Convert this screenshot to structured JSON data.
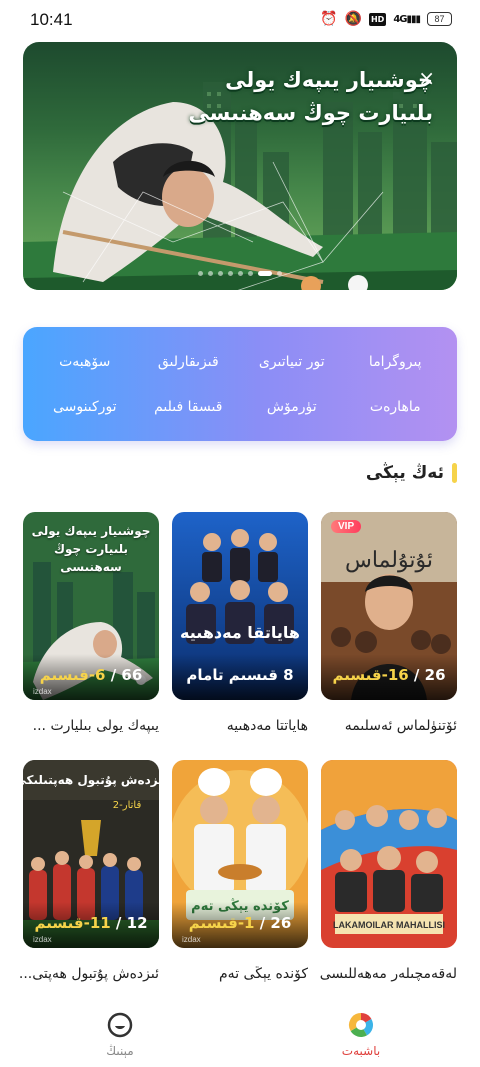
{
  "status_bar": {
    "time": "10:41",
    "network": "4G",
    "hd": "HD",
    "battery": "87",
    "icons": [
      "alarm-icon",
      "mute-icon",
      "hd-icon",
      "signal-icon",
      "battery-icon"
    ]
  },
  "banner": {
    "title_line1": "چوشىيار يىپەك يولى",
    "title_line2": "بلىيارت چوڭ سەھنىسى",
    "close_label": "×",
    "dots_count": 8,
    "active_dot": 6
  },
  "categories": [
    {
      "label": "پىروگراما"
    },
    {
      "label": "تور تىياتىرى"
    },
    {
      "label": "قىزىقارلىق"
    },
    {
      "label": "سۆھبەت"
    },
    {
      "label": "ماھارەت"
    },
    {
      "label": "تۈرمۆش"
    },
    {
      "label": "قىسقا فىلىم"
    },
    {
      "label": "توركىنوسى"
    }
  ],
  "section": {
    "title": "ئەڭ يېڭى"
  },
  "posters": [
    {
      "title": "ئۆتنۈلماس ئەسلىمە",
      "ep_total": "26",
      "ep_current": "16",
      "ep_word": "قىسىم",
      "vip": "VIP",
      "overlay": "",
      "watermark": "izdax",
      "theme": "warm"
    },
    {
      "title": "ھاياتتا مەدھىيە",
      "ep_total": "",
      "ep_current": "8",
      "ep_word": "قىسىم تامام",
      "vip": "",
      "overlay": "",
      "watermark": "izdax",
      "theme": "blue"
    },
    {
      "title": "يىپەك يولى بىليارت ...",
      "ep_total": "66",
      "ep_current": "6",
      "ep_word": "قىسىم",
      "vip": "",
      "overlay": "چوشىيار يىپەك يولى بلىيارت چوڭ سەھنىسى",
      "watermark": "izdax",
      "theme": "green"
    },
    {
      "title": "لەقەمچىلەر مەھەللىسى",
      "ep_total": "",
      "ep_current": "",
      "ep_word": "",
      "vip": "",
      "overlay": "",
      "watermark": "izdax",
      "theme": "red"
    },
    {
      "title": "كۆندە يېڭى تەم",
      "ep_total": "26",
      "ep_current": "1",
      "ep_word": "قىسىم",
      "vip": "",
      "overlay": "",
      "watermark": "izdax",
      "theme": "orange"
    },
    {
      "title": "ئىزدەش پۇتبول ھەپتى...",
      "ep_total": "12",
      "ep_current": "11",
      "ep_word": "قىسىم",
      "vip": "",
      "overlay": "",
      "watermark": "izdax",
      "theme": "dark"
    }
  ],
  "bottom_nav": [
    {
      "label": "باشبەت",
      "icon": "home-icon",
      "active": true
    },
    {
      "label": "مېنىڭ",
      "icon": "profile-icon",
      "active": false
    }
  ],
  "colors": {
    "accent": "#e0413d",
    "highlight": "#f6d34a",
    "category_gradient_start": "#4aa6ff",
    "category_gradient_end": "#b391f1"
  }
}
